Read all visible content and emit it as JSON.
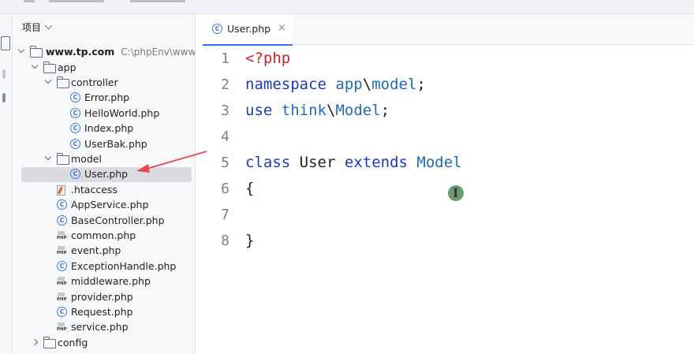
{
  "project": {
    "header_label": "项目",
    "root_label": "www.tp.com",
    "root_path": "C:\\phpEnv\\www\\w",
    "tree": [
      {
        "label": "app",
        "kind": "folder",
        "depth": 1,
        "open": true
      },
      {
        "label": "controller",
        "kind": "folder",
        "depth": 2,
        "open": true
      },
      {
        "label": "Error.php",
        "kind": "class",
        "depth": 3
      },
      {
        "label": "HelloWorld.php",
        "kind": "class",
        "depth": 3
      },
      {
        "label": "Index.php",
        "kind": "class",
        "depth": 3
      },
      {
        "label": "UserBak.php",
        "kind": "class",
        "depth": 3
      },
      {
        "label": "model",
        "kind": "folder",
        "depth": 2,
        "open": true
      },
      {
        "label": "User.php",
        "kind": "class",
        "depth": 3,
        "selected": true
      },
      {
        "label": ".htaccess",
        "kind": "htaccess",
        "depth": 2
      },
      {
        "label": "AppService.php",
        "kind": "class",
        "depth": 2
      },
      {
        "label": "BaseController.php",
        "kind": "class",
        "depth": 2
      },
      {
        "label": "common.php",
        "kind": "php",
        "depth": 2
      },
      {
        "label": "event.php",
        "kind": "php",
        "depth": 2
      },
      {
        "label": "ExceptionHandle.php",
        "kind": "class",
        "depth": 2
      },
      {
        "label": "middleware.php",
        "kind": "php",
        "depth": 2
      },
      {
        "label": "provider.php",
        "kind": "php",
        "depth": 2
      },
      {
        "label": "Request.php",
        "kind": "class",
        "depth": 2
      },
      {
        "label": "service.php",
        "kind": "php",
        "depth": 2
      },
      {
        "label": "config",
        "kind": "folder",
        "depth": 1,
        "open": false
      }
    ]
  },
  "editor": {
    "tab_label": "User.php",
    "tab_close": "×",
    "line_numbers": [
      "1",
      "2",
      "3",
      "4",
      "5",
      "6",
      "7",
      "8"
    ],
    "code": {
      "l1_tag": "<?php",
      "l2_kw": "namespace",
      "l2_ns": "app",
      "l2_sep": "\\",
      "l2_name": "model",
      "l2_end": ";",
      "l3_kw": "use",
      "l3_ns": "think",
      "l3_sep": "\\",
      "l3_name": "Model",
      "l3_end": ";",
      "l5_kw1": "class",
      "l5_name": "User",
      "l5_kw2": "extends",
      "l5_parent": "Model",
      "l6": "{",
      "l8": "}"
    }
  },
  "colors": {
    "keyword": "#1a3ab8",
    "php_tag": "#d0212a",
    "namespace": "#1f6bb6",
    "annotation_arrow": "#e8474f",
    "tab_accent": "#3574f0"
  }
}
